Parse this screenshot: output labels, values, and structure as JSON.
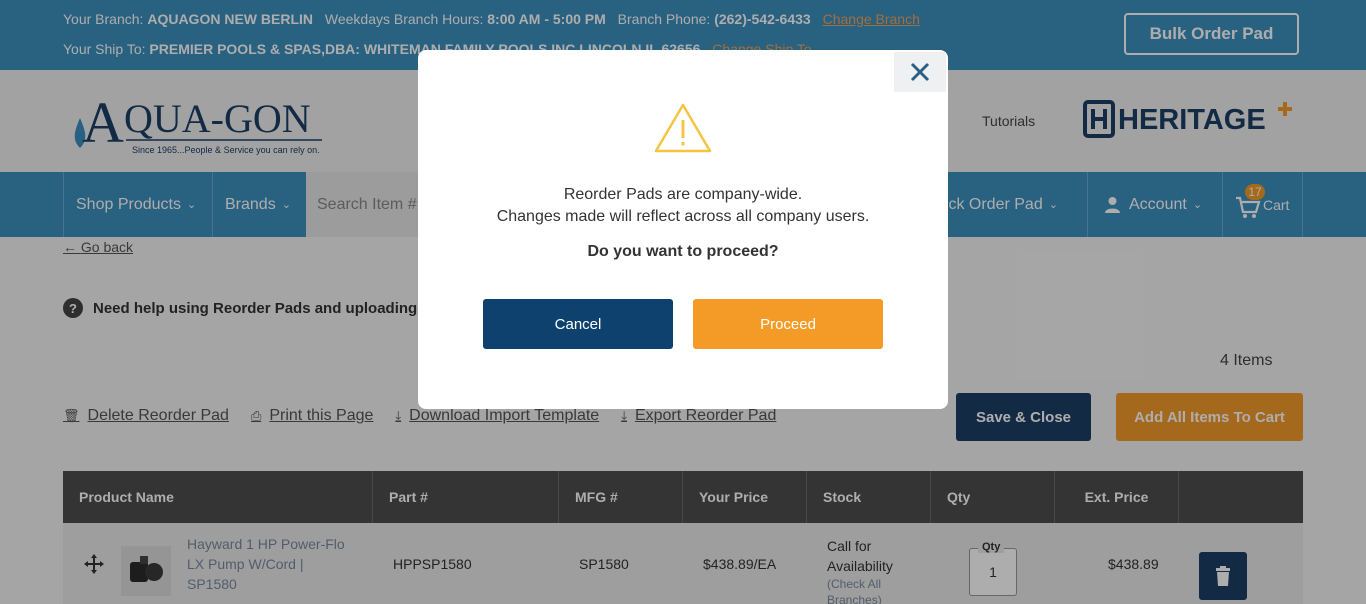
{
  "topbar": {
    "branch_label": "Your Branch:",
    "branch_name": "AQUAGON NEW BERLIN",
    "hours_label": "Weekdays Branch Hours:",
    "hours_value": "8:00 AM - 5:00 PM",
    "phone_label": "Branch Phone:",
    "phone_value": "(262)-542-6433",
    "change_branch": "Change Branch",
    "shipto_label": "Your Ship To:",
    "shipto_value": "PREMIER POOLS & SPAS,DBA: WHITEMAN FAMILY POOLS INC LINCOLN IL 62656",
    "change_shipto": "Change Ship To",
    "bulk_order": "Bulk Order Pad"
  },
  "header": {
    "logo_text": "QUA-GON",
    "logo_letter": "A",
    "logo_tagline": "Since 1965...People & Service you can rely on.",
    "tutorials": "Tutorials",
    "partner_logo": "HERITAGE"
  },
  "nav": {
    "shop_products": "Shop Products",
    "brands": "Brands",
    "search_placeholder": "Search Item #",
    "quick_order": "uick Order Pad",
    "account": "Account",
    "cart": "Cart",
    "cart_count": "17"
  },
  "page": {
    "go_back": "Go back",
    "help_text": "Need help using Reorder Pads and uploading",
    "items_count": "4 Items",
    "delete_pad": "Delete Reorder Pad",
    "print_page": "Print this Page",
    "download_template": "Download Import Template",
    "export_pad": "Export Reorder Pad",
    "save_close": "Save & Close",
    "add_all": "Add All Items To Cart"
  },
  "table": {
    "headers": [
      "Product Name",
      "Part #",
      "MFG #",
      "Your Price",
      "Stock",
      "Qty",
      "Ext. Price"
    ],
    "rows": [
      {
        "product": "Hayward 1 HP Power-Flo LX Pump W/Cord | SP1580",
        "part": "HPPSP1580",
        "mfg": "SP1580",
        "price": "$438.89/EA",
        "stock": "Call for Availability",
        "stock_link": "(Check All Branches)",
        "qty_label": "Qty",
        "qty": "1",
        "ext_price": "$438.89"
      }
    ]
  },
  "modal": {
    "line1": "Reorder Pads are company-wide.",
    "line2": "Changes made will reflect across all company users.",
    "question": "Do you want to proceed?",
    "cancel": "Cancel",
    "proceed": "Proceed"
  },
  "colors": {
    "brand_blue": "#3d8fbf",
    "navy": "#0f416f",
    "orange": "#f39b26"
  }
}
